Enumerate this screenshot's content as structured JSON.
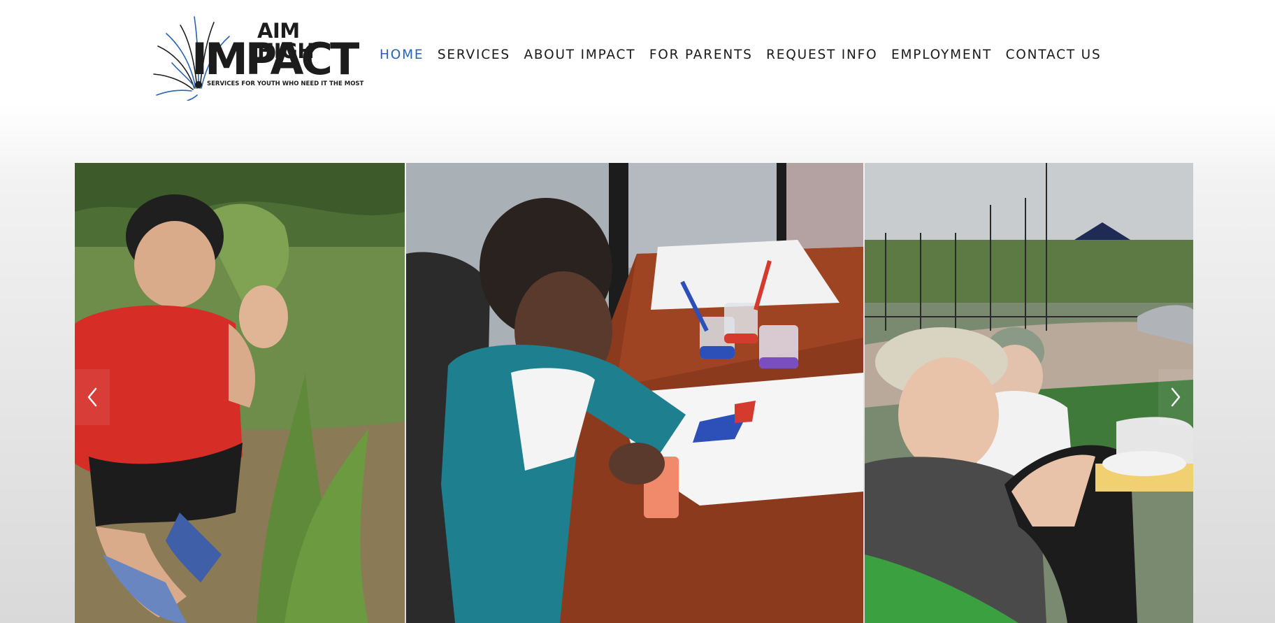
{
  "logo": {
    "line1": "AIM HIGH",
    "line2": "IMPACT",
    "tagline": "SERVICES FOR YOUTH WHO NEED IT THE MOST"
  },
  "nav": {
    "items": [
      {
        "label": "HOME",
        "active": true
      },
      {
        "label": "SERVICES"
      },
      {
        "label": "ABOUT IMPACT"
      },
      {
        "label": "FOR PARENTS"
      },
      {
        "label": "REQUEST INFO"
      },
      {
        "label": "EMPLOYMENT"
      },
      {
        "label": "CONTACT US"
      }
    ]
  },
  "slider": {
    "photos": [
      {
        "subject": "child crouching in garden"
      },
      {
        "subject": "child painting at table"
      },
      {
        "subject": "children sitting in park"
      }
    ],
    "prev_icon": "chevron-left-icon",
    "next_icon": "chevron-right-icon"
  },
  "colors": {
    "accent": "#2a62b5",
    "text": "#1a1a1a"
  }
}
